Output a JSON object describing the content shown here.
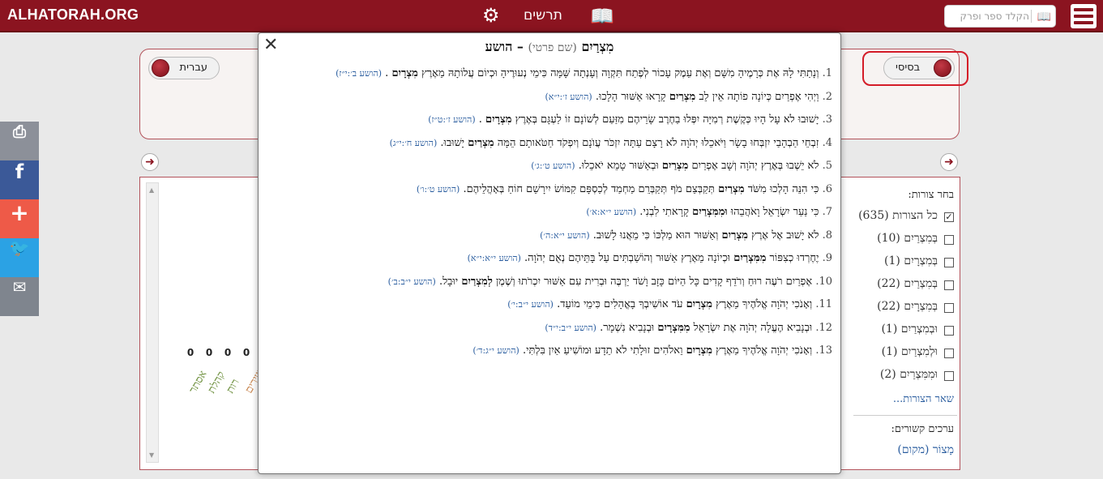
{
  "header": {
    "logo": "ALHATORAH.ORG",
    "years_label": "תרשים",
    "search_placeholder": "הקלד ספר ופרק"
  },
  "toggles": {
    "language": "עברית",
    "mode": "בסיסי"
  },
  "books_chart": [
    {
      "count": "0",
      "name": "אסתר",
      "color": "#6b8e3a"
    },
    {
      "count": "0",
      "name": "קהלת",
      "color": "#6b8e3a"
    },
    {
      "count": "0",
      "name": "רות",
      "color": "#6b8e3a"
    },
    {
      "count": "0",
      "name": "שיר השירים",
      "color": "#c6824a"
    }
  ],
  "filters": {
    "heading": "בחר צורות:",
    "items": [
      {
        "label": "כל הצורות (635)",
        "checked": true
      },
      {
        "label": "בְּמִצְרַיִם (10)",
        "checked": false
      },
      {
        "label": "בְּמִצְרָיִם (1)",
        "checked": false
      },
      {
        "label": "בְּמִצְרַיִם (22)",
        "checked": false
      },
      {
        "label": "בְּמִצְרָיִם (22)",
        "checked": false
      },
      {
        "label": "וּבְמִצְרַיִם (1)",
        "checked": false
      },
      {
        "label": "וּלְמִצְרַיִם (1)",
        "checked": false
      },
      {
        "label": "וּמִמִּצְרַיִם (2)",
        "checked": false
      }
    ],
    "more": "שאר הצורות...",
    "related_heading": "ערכים קשורים:",
    "related_link": "מָצוֹר (מקום)"
  },
  "share_icons": [
    "print-icon",
    "facebook-icon",
    "plus-icon",
    "twitter-icon",
    "mail-icon"
  ],
  "popup": {
    "title_word": "מִצְרַיִם",
    "title_pos": "(שם פרטי)",
    "title_dash": "–",
    "title_book": "הושע",
    "verses": [
      {
        "num": "1.",
        "before": "וְנָתַתִּי לָהּ אֶת כְּרָמֶיהָ מִשָּׁם וְאֶת עֵמֶק עָכוֹר לְפֶתַח תִּקְוָה וְעָנְתָה שָּׁמָּה כִּימֵי נְעוּרֶיהָ וּכְיוֹם עֲלוֹתָהּ מֵאֶרֶץ",
        "hl": "מִצְרָיִם",
        "after": ".",
        "ref": "(הושע ב׳:י״ז)"
      },
      {
        "num": "2.",
        "before": "וַיְהִי אֶפְרַיִם כְּיוֹנָה פוֹתָה אֵין לֵב",
        "hl": "מִצְרַיִם",
        "after": "קָרָאוּ אַשּׁוּר הָלָכוּ.",
        "ref": "(הושע ז׳:י״א)"
      },
      {
        "num": "3.",
        "before": "יָשׁוּבוּ לֹא עָל הָיוּ כְּקֶשֶׁת רְמִיָּה יִפְּלוּ בַחֶרֶב שָׂרֵיהֶם מִזַּעַם לְשׁוֹנָם זוֹ לַעְגָּם בְּאֶרֶץ",
        "hl": "מִצְרָיִם",
        "after": ".",
        "ref": "(הושע ז׳:ט״ז)"
      },
      {
        "num": "4.",
        "before": "זִבְחֵי הַבְהָבַי יִזְבְּחוּ בָשָׂר וַיֹּאכֵלוּ יְהֹוָה לֹא רָצָם עַתָּה יִזְכֹּר עֲוֺנָם וְיִפְקֹד חַטֹּאותָם הֵמָּה",
        "hl": "מִצְרַיִם",
        "after": "יָשׁוּבוּ.",
        "ref": "(הושע ח׳:י״ג)"
      },
      {
        "num": "5.",
        "before": "לֹא יֵשְׁבוּ בְּאֶרֶץ יְהֹוָה וְשָׁב אֶפְרַיִם",
        "hl": "מִצְרַיִם",
        "after": "וּבְאַשּׁוּר טָמֵא יֹאכֵלוּ.",
        "ref": "(הושע ט׳:ג׳)"
      },
      {
        "num": "6.",
        "before": "כִּי הִנֵּה הָלְכוּ מִשֹּׁד",
        "hl": "מִצְרַיִם",
        "after": "תְּקַבְּצֵם מֹף תְּקַבְּרֵם מַחְמַד לְכַסְפָּם קִמּוֹשׂ יִירָשֵׁם חוֹחַ בְּאָהֳלֵיהֶם.",
        "ref": "(הושע ט׳:ו׳)"
      },
      {
        "num": "7.",
        "before": "כִּי נַעַר יִשְׂרָאֵל וָאֹהֲבֵהוּ",
        "hl": "וּמִמִּצְרַיִם",
        "after": "קָרָאתִי לִבְנִי.",
        "ref": "(הושע י״א:א׳)"
      },
      {
        "num": "8.",
        "before": "לֹא יָשׁוּב אֶל אֶרֶץ",
        "hl": "מִצְרַיִם",
        "after": "וְאַשּׁוּר הוּא מַלְכּוֹ כִּי מֵאֲנוּ לָשׁוּב.",
        "ref": "(הושע י״א:ה׳)"
      },
      {
        "num": "9.",
        "before": "יֶחֶרְדוּ כְצִפּוֹר",
        "hl": "מִמִּצְרַיִם",
        "after": "וּכְיוֹנָה מֵאֶרֶץ אַשּׁוּר וְהוֹשַׁבְתִּים עַל בָּתֵּיהֶם נְאֻם יְהֹוָה.",
        "ref": "(הושע י״א:י״א)"
      },
      {
        "num": "10.",
        "before": "אֶפְרַיִם רֹעֶה רוּחַ וְרֹדֵף קָדִים כָּל הַיּוֹם כָּזָב וָשֹׁד יַרְבֶּה וּבְרִית עִם אַשּׁוּר יִכְרֹתוּ וְשֶׁמֶן",
        "hl": "לְמִצְרַיִם",
        "after": "יוּבָל.",
        "ref": "(הושע י״ב:ב׳)"
      },
      {
        "num": "11.",
        "before": "וְאָנֹכִי יְהֹוָה אֱלֹהֶיךָ מֵאֶרֶץ",
        "hl": "מִצְרָיִם",
        "after": "עֹד אוֹשִׁיבְךָ בָאֳהָלִים כִּימֵי מוֹעֵד.",
        "ref": "(הושע י״ב:י׳)"
      },
      {
        "num": "12.",
        "before": "וּבְנָבִיא הֶעֱלָה יְהֹוָה אֶת יִשְׂרָאֵל",
        "hl": "מִמִּצְרָיִם",
        "after": "וּבְנָבִיא נִשְׁמָר.",
        "ref": "(הושע י״ב:י״ד)"
      },
      {
        "num": "13.",
        "before": "וְאָנֹכִי יְהֹוָה אֱלֹהֶיךָ מֵאֶרֶץ",
        "hl": "מִצְרָיִם",
        "after": "וֵאלֹהִים זוּלָתִי לֹא תֵדָע וּמוֹשִׁיעַ אַיִן בִּלְתִּי.",
        "ref": "(הושע י״ג:ד׳)"
      }
    ]
  }
}
